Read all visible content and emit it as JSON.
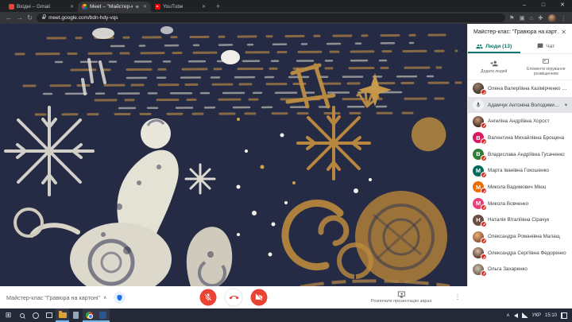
{
  "ui": {
    "close": "✕",
    "plus": "+",
    "minimize": "–",
    "maximize": "□",
    "back": "←",
    "forward": "→",
    "reload": "↻",
    "menu": "⋮",
    "chevron_down": "▾",
    "chevron_up": "∧",
    "bookmark_flag": "⚑",
    "cast": "▣",
    "home": "⌂",
    "extensions": "✚",
    "start": "⊞"
  },
  "browser": {
    "tabs": [
      {
        "title": "Вхідні – Gmail"
      },
      {
        "title": "Meet – \"Майстер-клас \"Грав…\""
      },
      {
        "title": "YouTube"
      }
    ],
    "url": "meet.google.com/bdn-hdy-vqs"
  },
  "sidebar": {
    "title": "Майстер-клас: \"Гравюра на карт…",
    "people_tab": "Люди (13)",
    "chat_tab": "Чат",
    "add_people": "Додати людей",
    "host_controls": "Елементи керування розміщенням",
    "participants": [
      {
        "name": "Олена Валеріївна Казімірченко (ві…",
        "letter": "",
        "avatar_style": "background:radial-gradient(circle at 40% 30%,#9c8066,#41322a 75%)"
      },
      {
        "name": "Адамчук Антоніна Володими…",
        "letter": "",
        "avatar_style": "background:#f1f3f4"
      },
      {
        "name": "Ангеліна Андріївна Хорост",
        "letter": "",
        "avatar_style": "background:radial-gradient(circle at 45% 35%,#c79a7d,#3c2219 75%)"
      },
      {
        "name": "Валентина Михайлівна Брощена",
        "letter": "В",
        "avatar_style": "background:#d81b60"
      },
      {
        "name": "Владислава Андріївна Гусаченко",
        "letter": "В",
        "avatar_style": "background:#2e7d32"
      },
      {
        "name": "Марта Іванівна Гокошенко",
        "letter": "М",
        "avatar_style": "background:#00695c"
      },
      {
        "name": "Микола Вадимович Міюц",
        "letter": "М",
        "avatar_style": "background:#ef6c00"
      },
      {
        "name": "Микола Вовченко",
        "letter": "М",
        "avatar_style": "background:#ec407a"
      },
      {
        "name": "Наталія Віталіївна Сірачук",
        "letter": "Н",
        "avatar_style": "background:#6d4c41"
      },
      {
        "name": "Олександра Романівна Малащ",
        "letter": "",
        "avatar_style": "background:radial-gradient(circle at 40% 35%,#e8b27a,#8a4a36 75%)"
      },
      {
        "name": "Олександра Сергіївна Федоренко",
        "letter": "",
        "avatar_style": "background:radial-gradient(circle at 45% 35%,#d9bda4,#55382c 75%)"
      },
      {
        "name": "Ольга Захаренко",
        "letter": "",
        "avatar_style": "background:radial-gradient(circle at 45% 40%,#cfc0ad,#6e5c4c 75%)"
      }
    ]
  },
  "meet_bar": {
    "meeting_name": "Майстер-клас \"Гравюра на картоні\"",
    "present_label": "Розпочати презентацію зараз"
  },
  "taskbar": {
    "lang": "УКР",
    "time": "15:10"
  },
  "colors": {
    "accent_teal": "#00796b",
    "badge_red": "#d93025",
    "control_red": "#ea4335",
    "shield_blue": "#1a73e8"
  }
}
